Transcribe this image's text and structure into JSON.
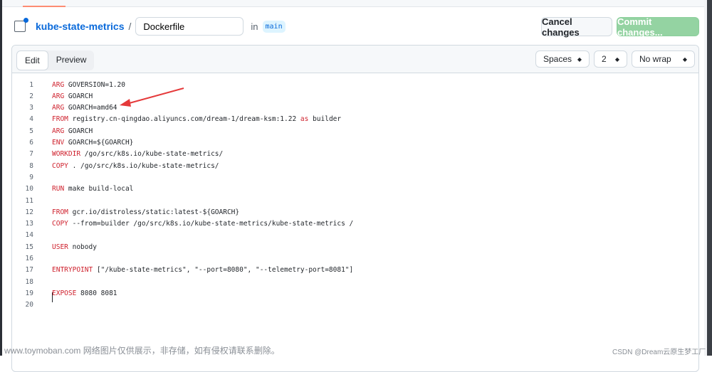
{
  "header": {
    "repo": "kube-state-metrics",
    "separator": "/",
    "filename": "Dockerfile",
    "in_label": "in",
    "branch": "main"
  },
  "actions": {
    "cancel": "Cancel changes",
    "commit": "Commit changes..."
  },
  "editor": {
    "tabs": [
      {
        "label": "Edit",
        "active": true
      },
      {
        "label": "Preview",
        "active": false
      }
    ],
    "indent_mode": "Spaces",
    "indent_size": "2",
    "wrap_mode": "No wrap",
    "lines": [
      {
        "n": "1",
        "kw": "ARG",
        "rest": " GOVERSION=1.20"
      },
      {
        "n": "2",
        "kw": "ARG",
        "rest": " GOARCH"
      },
      {
        "n": "3",
        "kw": "ARG",
        "rest": " GOARCH=amd64"
      },
      {
        "n": "4",
        "kw": "FROM",
        "rest": " registry.cn-qingdao.aliyuncs.com/dream-1/dream-ksm:1.22 ",
        "kw2": "as",
        "rest2": " builder"
      },
      {
        "n": "5",
        "kw": "ARG",
        "rest": " GOARCH"
      },
      {
        "n": "6",
        "kw": "ENV",
        "rest": " GOARCH=${GOARCH}"
      },
      {
        "n": "7",
        "kw": "WORKDIR",
        "rest": " /go/src/k8s.io/kube-state-metrics/"
      },
      {
        "n": "8",
        "kw": "COPY",
        "rest": " . /go/src/k8s.io/kube-state-metrics/"
      },
      {
        "n": "9",
        "kw": "",
        "rest": ""
      },
      {
        "n": "10",
        "kw": "RUN",
        "rest": " make build-local"
      },
      {
        "n": "11",
        "kw": "",
        "rest": ""
      },
      {
        "n": "12",
        "kw": "FROM",
        "rest": " gcr.io/distroless/static:latest-${GOARCH}"
      },
      {
        "n": "13",
        "kw": "COPY",
        "rest": " --from=builder /go/src/k8s.io/kube-state-metrics/kube-state-metrics /"
      },
      {
        "n": "14",
        "kw": "",
        "rest": ""
      },
      {
        "n": "15",
        "kw": "USER",
        "rest": " nobody"
      },
      {
        "n": "16",
        "kw": "",
        "rest": ""
      },
      {
        "n": "17",
        "kw": "ENTRYPOINT",
        "rest": " [\"/kube-state-metrics\", \"--port=8080\", \"--telemetry-port=8081\"]"
      },
      {
        "n": "18",
        "kw": "",
        "rest": ""
      },
      {
        "n": "19",
        "kw": "EXPOSE",
        "rest": " 8080 8081"
      },
      {
        "n": "20",
        "kw": "",
        "rest": ""
      }
    ]
  },
  "watermark": {
    "left": "www.toymoban.com 网络图片仅供展示，非存储，如有侵权请联系删除。",
    "right": "CSDN @Dream云原生梦工厂"
  },
  "colors": {
    "link": "#0969da",
    "keyword": "#cf222e",
    "commit_disabled": "#94d3a2",
    "arrow": "#e5393a"
  }
}
